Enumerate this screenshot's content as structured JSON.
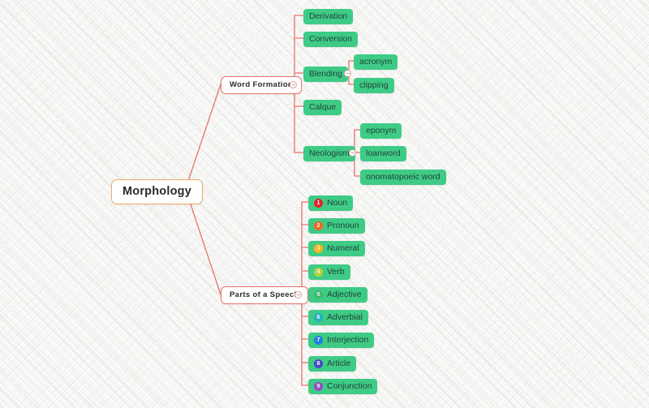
{
  "theme": {
    "background_color": "#f2f2f0",
    "connector_color": "#e8736b",
    "root_border_color": "#edab63",
    "branch_border_color": "#e8736b",
    "leaf_fill_color": "#3ecb86",
    "leaf_text_color": "#23423a"
  },
  "root": {
    "label": "Morphology"
  },
  "branches": [
    {
      "label": "Word Formation",
      "children": [
        {
          "label": "Derivation"
        },
        {
          "label": "Conversion"
        },
        {
          "label": "Blending",
          "children": [
            {
              "label": "acronym"
            },
            {
              "label": "clipping"
            }
          ]
        },
        {
          "label": "Calque"
        },
        {
          "label": "Neologism",
          "children": [
            {
              "label": "eponym"
            },
            {
              "label": "loanword"
            },
            {
              "label": "onomatopoeic word"
            }
          ]
        }
      ]
    },
    {
      "label": "Parts of a Speech",
      "children": [
        {
          "number": "1",
          "label": "Noun",
          "badge_color": "#e8202a"
        },
        {
          "number": "2",
          "label": "Pronoun",
          "badge_color": "#f26722"
        },
        {
          "number": "3",
          "label": "Numeral",
          "badge_color": "#fdb515"
        },
        {
          "number": "4",
          "label": "Verb",
          "badge_color": "#b7d43a"
        },
        {
          "number": "5",
          "label": "Adjective",
          "badge_color": "#3bbf6e"
        },
        {
          "number": "6",
          "label": "Adverbial",
          "badge_color": "#21b3c4"
        },
        {
          "number": "7",
          "label": "Interjection",
          "badge_color": "#1f7fe0"
        },
        {
          "number": "8",
          "label": "Article",
          "badge_color": "#4a49c9"
        },
        {
          "number": "9",
          "label": "Conjunction",
          "badge_color": "#9a49c9"
        }
      ]
    }
  ]
}
